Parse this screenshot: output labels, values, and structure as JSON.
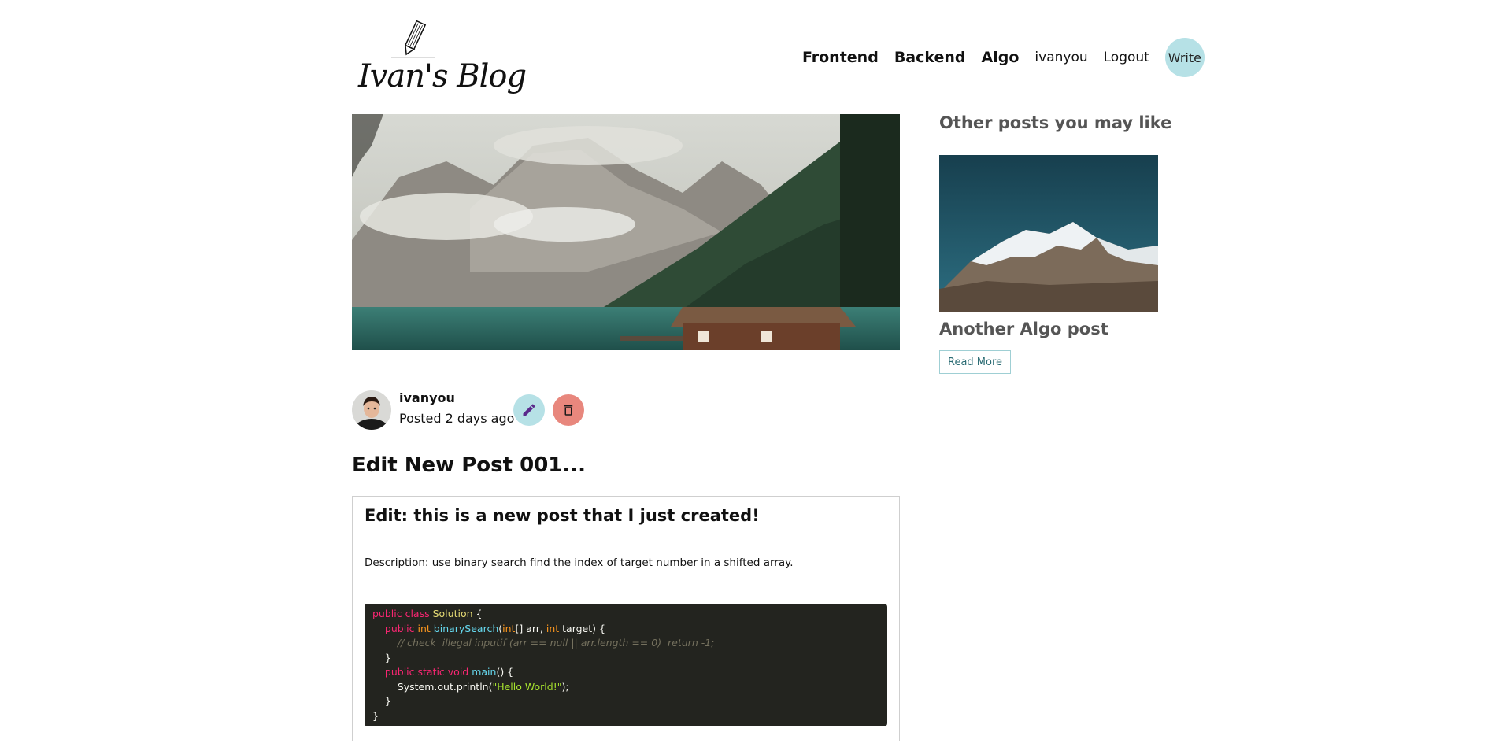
{
  "logo": {
    "text": "Ivan's Blog",
    "icon": "pencil-icon"
  },
  "nav": {
    "links": [
      "Frontend",
      "Backend",
      "Algo"
    ],
    "username": "ivanyou",
    "logout": "Logout",
    "write": "Write"
  },
  "post": {
    "author": "ivanyou",
    "posted": "Posted 2 days ago",
    "title": "Edit New Post 001...",
    "content_heading": "Edit: this is a new post that I just created!",
    "description": "Description: use binary search find the index of target number in a shifted array.",
    "code": [
      [
        [
          "kw",
          "public class "
        ],
        [
          "cls",
          "Solution"
        ],
        [
          "p",
          " {"
        ]
      ],
      [
        [
          "p",
          "    "
        ],
        [
          "kw",
          "public "
        ],
        [
          "ty",
          "int "
        ],
        [
          "fn",
          "binarySearch"
        ],
        [
          "p",
          "("
        ],
        [
          "ty",
          "int"
        ],
        [
          "p",
          "[] arr, "
        ],
        [
          "ty",
          "int"
        ],
        [
          "p",
          " target) {"
        ]
      ],
      [
        [
          "cm",
          "        // check  illegal inputif (arr == null || arr.length == 0)  return -1;"
        ]
      ],
      [
        [
          "p",
          "    }"
        ]
      ],
      [
        [
          "p",
          "    "
        ],
        [
          "kw",
          "public static void "
        ],
        [
          "fn",
          "main"
        ],
        [
          "p",
          "() {"
        ]
      ],
      [
        [
          "p",
          "        System.out.println("
        ],
        [
          "str",
          "\"Hello World!\""
        ],
        [
          "p",
          ");"
        ]
      ],
      [
        [
          "p",
          "    }"
        ]
      ],
      [
        [
          "p",
          "}"
        ]
      ]
    ]
  },
  "sidebar": {
    "title": "Other posts you may like",
    "post_title": "Another Algo post",
    "read_more": "Read More"
  },
  "colors": {
    "accent": "#b6e1e6",
    "danger": "#e8877d",
    "code_bg": "#23241f"
  }
}
